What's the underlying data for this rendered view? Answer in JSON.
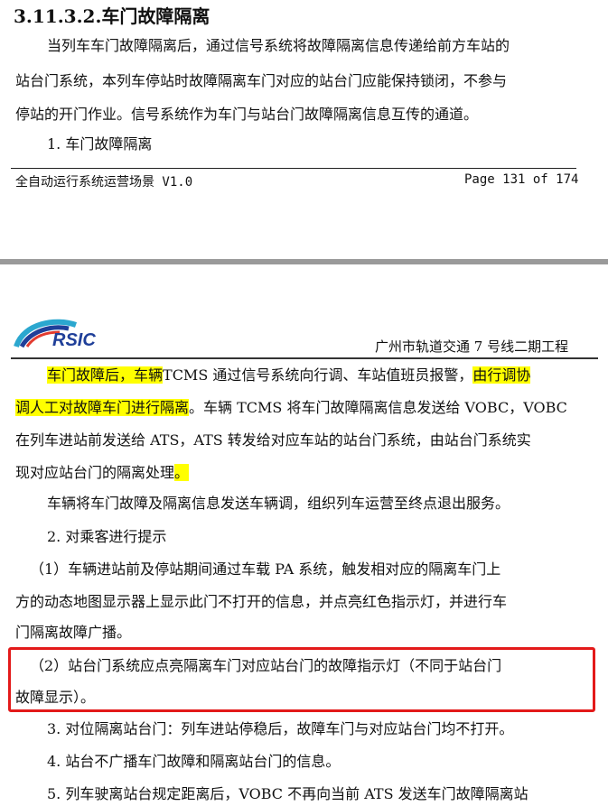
{
  "page1": {
    "section_title": "3.11.3.2.车门故障隔离",
    "para1": [
      "当列车车门故障隔离后，通过信号系统将故障隔离信息传递给前方车站的",
      "站台门系统，本列车停站时故障隔离车门对应的站台门应能保持锁闭，不参与",
      "停站的开门作业。信号系统作为车门与站台门故障隔离信息互传的通道。"
    ],
    "item1": "1.  车门故障隔离",
    "footer_left": "全自动运行系统运营场景 V1.0",
    "footer_right": "Page 131 of 174"
  },
  "page2": {
    "logo_text": "RSIC",
    "project_name": "广州市轨道交通 7 号线二期工程",
    "l1_hl1": "车门故障后，车辆",
    "l1_mid": "TCMS 通过信号系统向行调、车站值班员报警，",
    "l1_hl2": "由行调协",
    "l2_hl": "调人工对故障车门进行隔离",
    "l2_rest": "。车辆 TCMS 将车门故障隔离信息发送给 VOBC，VOBC",
    "l3": "在列车进站前发送给 ATS，ATS 转发给对应车站的站台门系统，由站台门系统实",
    "l4_text": "现对应站台门的隔离处理",
    "l4_hl": "。",
    "l5": "车辆将车门故障及隔离信息发送车辆调，组织列车运营至终点退出服务。",
    "item2": "2.  对乘客进行提示",
    "sub1": [
      "（1）车辆进站前及停站期间通过车载 PA 系统，触发相对应的隔离车门上",
      "方的动态地图显示器上显示此门不打开的信息，并点亮红色指示灯，并进行车",
      "门隔离故障广播。"
    ],
    "sub2": [
      "（2）站台门系统应点亮隔离车门对应站台门的故障指示灯（不同于站台门",
      "故障显示）。"
    ],
    "item3": "3.  对位隔离站台门：列车进站停稳后，故障车门与对应站台门均不打开。",
    "item4": "4.  站台不广播车门故障和隔离站台门的信息。",
    "item5": "5.  列车驶离站台规定距离后，VOBC 不再向当前 ATS 发送车门故障隔离站"
  },
  "colors": {
    "highlight": "#ffff00",
    "redbox": "#e31a1a",
    "logo_blue": "#1f3f99"
  }
}
